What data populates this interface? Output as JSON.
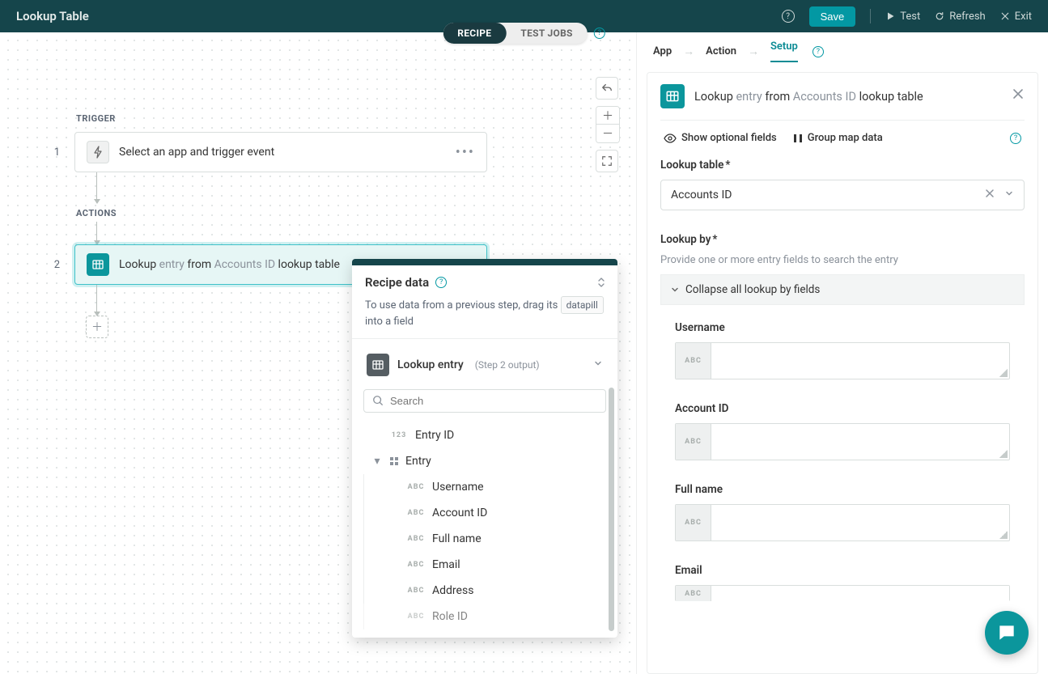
{
  "header": {
    "title": "Lookup Table",
    "save": "Save",
    "test": "Test",
    "refresh": "Refresh",
    "exit": "Exit"
  },
  "modeTabs": {
    "recipe": "RECIPE",
    "testJobs": "TEST JOBS"
  },
  "canvas": {
    "triggerLabel": "TRIGGER",
    "actionsLabel": "ACTIONS",
    "step1": {
      "num": "1",
      "text": "Select an app and trigger event"
    },
    "step2": {
      "num": "2",
      "prefix": "Lookup ",
      "entry": "entry",
      "from": " from ",
      "table": "Accounts ID",
      "suffix": " lookup table"
    }
  },
  "popover": {
    "title": "Recipe data",
    "sub1": "To use data from a previous step, drag its",
    "chip": "datapill",
    "sub2": " into a field",
    "dsName": "Lookup entry",
    "dsMeta": "(Step 2 output)",
    "searchPlaceholder": "Search",
    "tree": {
      "entryId": "Entry ID",
      "entry": "Entry",
      "username": "Username",
      "accountId": "Account ID",
      "fullName": "Full name",
      "email": "Email",
      "address": "Address",
      "roleId": "Role ID"
    },
    "typeNum": "123",
    "typeAbc": "ABC"
  },
  "right": {
    "bcApp": "App",
    "bcAction": "Action",
    "bcSetup": "Setup",
    "title": {
      "prefix": "Lookup ",
      "entry": "entry",
      "from": " from ",
      "table": "Accounts ID",
      "suffix": " lookup table"
    },
    "showOptional": "Show optional fields",
    "groupMap": "Group map data",
    "lookupTableLabel": "Lookup table",
    "lookupTableValue": "Accounts ID",
    "lookupByLabel": "Lookup by",
    "lookupByHint": "Provide one or more entry fields to search the entry",
    "collapseAll": "Collapse all lookup by fields",
    "fields": {
      "username": "Username",
      "accountId": "Account ID",
      "fullName": "Full name",
      "email": "Email"
    },
    "asterisk": "*",
    "abc": "ABC"
  }
}
